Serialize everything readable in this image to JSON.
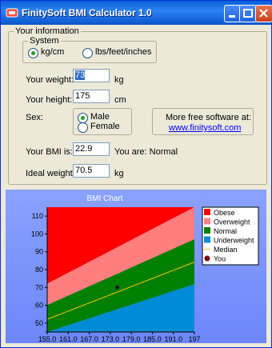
{
  "window": {
    "title": "FinitySoft BMI Calculator 1.0"
  },
  "info": {
    "group_label": "Your information",
    "system": {
      "label": "System",
      "options": [
        "kg/cm",
        "lbs/feet/inches"
      ],
      "selected": "kg/cm"
    },
    "weight": {
      "label": "Your weight:",
      "value": "73",
      "unit": "kg"
    },
    "height": {
      "label": "Your height:",
      "value": "175",
      "unit": "cm"
    },
    "sex": {
      "label": "Sex:",
      "options": [
        "Male",
        "Female"
      ],
      "selected": "Male"
    },
    "promo": {
      "text": "More free software at:",
      "link": "www.finitysoft.com"
    },
    "bmi": {
      "label": "Your BMI is:",
      "value": "22.9",
      "result": "You are: Normal"
    },
    "ideal": {
      "label": "Ideal weight:",
      "value": "70.5",
      "unit": "kg"
    }
  },
  "chart_data": {
    "type": "area",
    "title": "BMI Chart",
    "x_ticks": [
      "155.0",
      "161.0",
      "167.0",
      "173.0",
      "179.0",
      "185.0",
      "191.0",
      "197"
    ],
    "y_ticks": [
      "110",
      "100",
      "90",
      "80",
      "70",
      "60",
      "50"
    ],
    "xlim": [
      155,
      197
    ],
    "ylim": [
      45,
      115
    ],
    "bmi_bounds": {
      "underweight": 18.5,
      "normal_max": 25,
      "overweight_max": 30
    },
    "median_bmi": 21.7,
    "point": {
      "height": 175,
      "weight": 70
    },
    "legend": [
      {
        "name": "Obese",
        "color": "#ff0000"
      },
      {
        "name": "Overweight",
        "color": "#ff7f7f"
      },
      {
        "name": "Normal",
        "color": "#008000"
      },
      {
        "name": "Underweight",
        "color": "#008bd6"
      },
      {
        "name": "Median",
        "color": "#f2c200"
      },
      {
        "name": "You",
        "color": "#7a1010"
      }
    ],
    "legend_position": "right"
  }
}
